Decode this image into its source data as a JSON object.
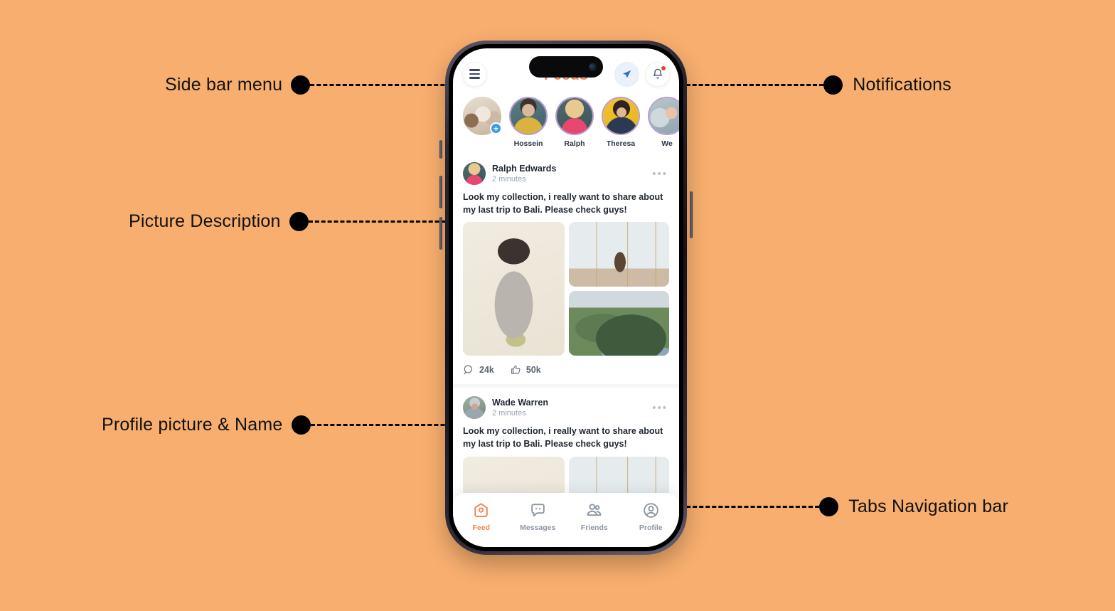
{
  "background_color": "#f7ae6e",
  "accent_color": "#f3834a",
  "annotations": [
    {
      "id": "side-bar-menu",
      "label": "Side bar menu",
      "side": "left"
    },
    {
      "id": "notifications",
      "label": "Notifications",
      "side": "right"
    },
    {
      "id": "picture-description",
      "label": "Picture Description",
      "side": "left"
    },
    {
      "id": "profile-picture-name",
      "label": "Profile picture & Name",
      "side": "left"
    },
    {
      "id": "tabs-navigation-bar",
      "label": "Tabs Navigation bar",
      "side": "right"
    }
  ],
  "app": {
    "header": {
      "title": "Feeds",
      "menu_icon": "hamburger-menu-icon",
      "send_icon": "paper-plane-icon",
      "notification_icon": "bell-icon",
      "has_notification_dot": true
    },
    "stories": [
      {
        "name": "",
        "add": true,
        "ring": false
      },
      {
        "name": "Hossein",
        "add": false,
        "ring": true
      },
      {
        "name": "Ralph",
        "add": false,
        "ring": true
      },
      {
        "name": "Theresa",
        "add": false,
        "ring": true
      },
      {
        "name": "We",
        "add": false,
        "ring": true
      }
    ],
    "posts": [
      {
        "author": "Ralph Edwards",
        "time": "2 minutes",
        "more_icon": "more-options-icon",
        "text": "Look my collection, i really want to share about my last trip to Bali. Please check guys!",
        "stats": {
          "comments_icon": "comment-icon",
          "comments": "24k",
          "likes_icon": "thumbs-up-icon",
          "likes": "50k"
        }
      },
      {
        "author": "Wade Warren",
        "time": "2 minutes",
        "more_icon": "more-options-icon",
        "text": "Look my collection, i really want to share about my last trip to Bali. Please check guys!"
      }
    ],
    "tabs": [
      {
        "label": "Feed",
        "icon": "home-icon",
        "active": true
      },
      {
        "label": "Messages",
        "icon": "chat-icon",
        "active": false
      },
      {
        "label": "Friends",
        "icon": "friends-icon",
        "active": false
      },
      {
        "label": "Profile",
        "icon": "profile-icon",
        "active": false
      }
    ]
  }
}
